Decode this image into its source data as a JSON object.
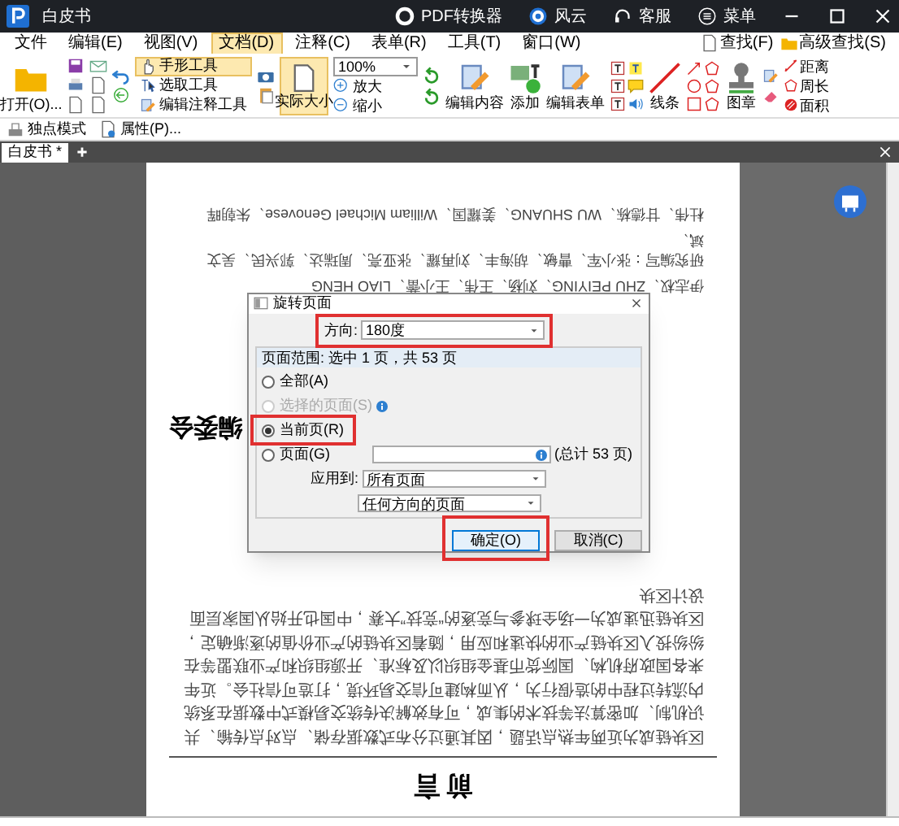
{
  "window": {
    "title": "白皮书",
    "actions": [
      "PDF转换器",
      "风云",
      "客服",
      "菜单"
    ]
  },
  "menu": [
    {
      "label": "文件",
      "selected": false
    },
    {
      "label": "编辑(E)",
      "selected": false
    },
    {
      "label": "视图(V)",
      "selected": false
    },
    {
      "label": "文档(D)",
      "selected": true
    },
    {
      "label": "注释(C)",
      "selected": false
    },
    {
      "label": "表单(R)",
      "selected": false
    },
    {
      "label": "工具(T)",
      "selected": false
    },
    {
      "label": "窗口(W)",
      "selected": false
    }
  ],
  "search": [
    "查找(F)",
    "高级查找(S)"
  ],
  "ribbon": {
    "open": "打开(O)...",
    "tools": [
      {
        "label": "手形工具",
        "selected": true
      },
      {
        "label": "选取工具",
        "selected": false
      },
      {
        "label": "编辑注释工具",
        "selected": false
      }
    ],
    "actual_size": {
      "label": "实际大小",
      "selected": true
    },
    "zoom": "100%",
    "zoom_in": "放大",
    "zoom_out": "缩小",
    "edit": [
      "编辑内容",
      "添加",
      "编辑表单"
    ],
    "line": "线条",
    "stamp": "图章",
    "measure": [
      "距离",
      "周长",
      "面积"
    ]
  },
  "subbar": [
    "独点模式",
    "属性(P)..."
  ],
  "tabs": [
    {
      "label": "白皮书 *",
      "selected": true
    }
  ],
  "document": {
    "title": "前 言",
    "paragraph": "区块链成为近两年热点话题，因其通过分布式数据存储、点对点传输、共识机制、加密算法等技术的集成，可有效解决传统交易模式中数据在系统内流转过程中的造假行为，从而构建可信交易环境，打造可信社会。近年来各国政府机构、国际货币基金组织以及标准、开源组织和产业联盟等在纷纷投入区块链产业的快速和应用，随着区块链的产业价值的逐渐确定，区块链迅速成为一场全球参与竞逐的“竞技”大赛，中国也开始从国家层面设计区块",
    "heading": "编委会",
    "names": [
      "伊志权、ZHU PEIYING、刘杨、王伟、王小蕾、LIAO HENG",
      "研究编写：张小军、曹敏、胡海丰、刘再耀、张亚亮、周瑞达、郭兴民、吴文斌、",
      "杜伟、甘德栋、WU SHUANG、姜耀国、William Michael Genovese、朱朝晖"
    ]
  },
  "dialog": {
    "title": "旋转页面",
    "direction_label": "方向:",
    "direction": "180度",
    "range_caption": "页面范围: 选中 1 页，共 53 页",
    "options": [
      {
        "label": "全部(A)",
        "selected": false,
        "disabled": false
      },
      {
        "label": "选择的页面(S)",
        "selected": false,
        "disabled": true
      },
      {
        "label": "当前页(R)",
        "selected": true,
        "disabled": false
      },
      {
        "label": "页面(G)",
        "selected": false,
        "disabled": false
      }
    ],
    "total": "(总计 53 页)",
    "apply_label": "应用到:",
    "apply": "所有页面",
    "orientation": "任何方向的页面",
    "buttons": [
      "确定(O)",
      "取消(C)"
    ]
  }
}
